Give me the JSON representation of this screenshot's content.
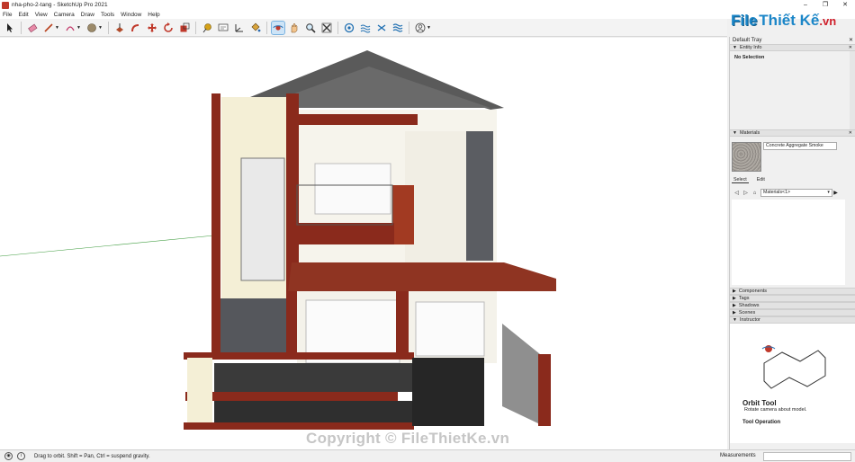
{
  "window": {
    "title": "nha-pho-2-tang - SketchUp Pro 2021",
    "controls": [
      "–",
      "❐",
      "✕"
    ]
  },
  "menu": [
    "File",
    "Edit",
    "View",
    "Camera",
    "Draw",
    "Tools",
    "Window",
    "Help"
  ],
  "toolbar": {
    "tools": [
      "select-tool",
      "eraser-tool",
      "line-tool",
      "arc-tool",
      "shapes-tool",
      "push-pull-tool",
      "follow-me-tool",
      "move-tool",
      "rotate-tool",
      "scale-tool",
      "tape-measure-tool",
      "text-tool",
      "paint-bucket-tool",
      "orbit-tool",
      "pan-tool",
      "zoom-tool",
      "zoom-extents-tool",
      "3d-warehouse",
      "extension-warehouse",
      "layout",
      "extension-manager",
      "account"
    ],
    "active_tool": "orbit-tool"
  },
  "tray": {
    "title": "Default Tray",
    "entity_info": {
      "header": "Entity Info",
      "value": "No Selection"
    },
    "materials": {
      "header": "Materials",
      "current_material": "Concrete Aggregate Smoke",
      "tabs": [
        "Select",
        "Edit"
      ],
      "selected_tab": "Select",
      "collection": "Materials<1>"
    },
    "collapsed_panels": [
      "Components",
      "Tags",
      "Shadows",
      "Scenes"
    ],
    "instructor": {
      "header": "Instructor",
      "tool_name": "Orbit Tool",
      "tool_desc": "Rotate camera about model.",
      "section": "Tool Operation"
    }
  },
  "status": {
    "hint": "Drag to orbit. Shift = Pan, Ctrl = suspend gravity.",
    "measurements_label": "Measurements"
  },
  "branding": {
    "logo_part1": "File",
    "logo_part2": "Thiết Kế",
    "logo_part3": ".vn",
    "watermark": "Copyright © FileThietKe.vn"
  },
  "colors": {
    "accent_blue": "#1b86c8",
    "brand_red": "#cf1f2a",
    "roof": "#4d4d4d",
    "trim_red": "#8a2a1c"
  }
}
